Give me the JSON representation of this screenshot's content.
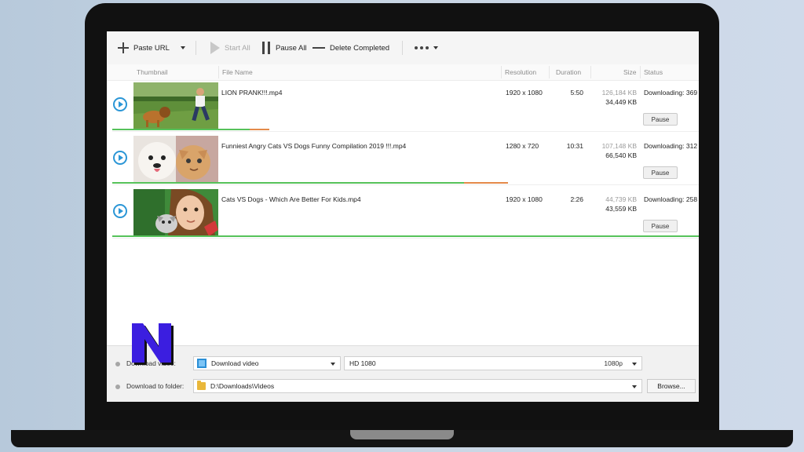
{
  "toolbar": {
    "paste_url": "Paste URL",
    "start_all": "Start All",
    "pause_all": "Pause All",
    "delete_completed": "Delete Completed"
  },
  "columns": {
    "thumbnail": "Thumbnail",
    "file_name": "File Name",
    "resolution": "Resolution",
    "duration": "Duration",
    "size": "Size",
    "status": "Status"
  },
  "downloads": [
    {
      "file_name": "LION PRANK!!!.mp4",
      "resolution": "1920 x 1080",
      "duration": "5:50",
      "total_size": "126,184 KB",
      "downloaded_size": "34,449 KB",
      "status": "Downloading: 369",
      "action": "Pause",
      "progress": 0.27
    },
    {
      "file_name": "Funniest Angry Cats VS Dogs Funny Compilation 2019 !!!.mp4",
      "resolution": "1280 x 720",
      "duration": "10:31",
      "total_size": "107,148 KB",
      "downloaded_size": "66,540 KB",
      "status": "Downloading: 312",
      "action": "Pause",
      "progress": 0.62
    },
    {
      "file_name": "Cats VS Dogs - Which Are Better For Kids.mp4",
      "resolution": "1920 x 1080",
      "duration": "2:26",
      "total_size": "44,739 KB",
      "downloaded_size": "43,559 KB",
      "status": "Downloading: 258",
      "action": "Pause",
      "progress": 0.97
    }
  ],
  "bottom": {
    "download_label": "Download video:",
    "download_value": "Download video",
    "quality_value": "HD 1080",
    "quality_suffix": "1080p",
    "folder_label": "Download to folder:",
    "folder_value": "D:\\Downloads\\Videos",
    "browse_label": "Browse..."
  },
  "colors": {
    "accent": "#2b96d6",
    "progress_done": "#56c25a",
    "progress_active": "#e48a4a",
    "logo": "#3b1ee0"
  }
}
